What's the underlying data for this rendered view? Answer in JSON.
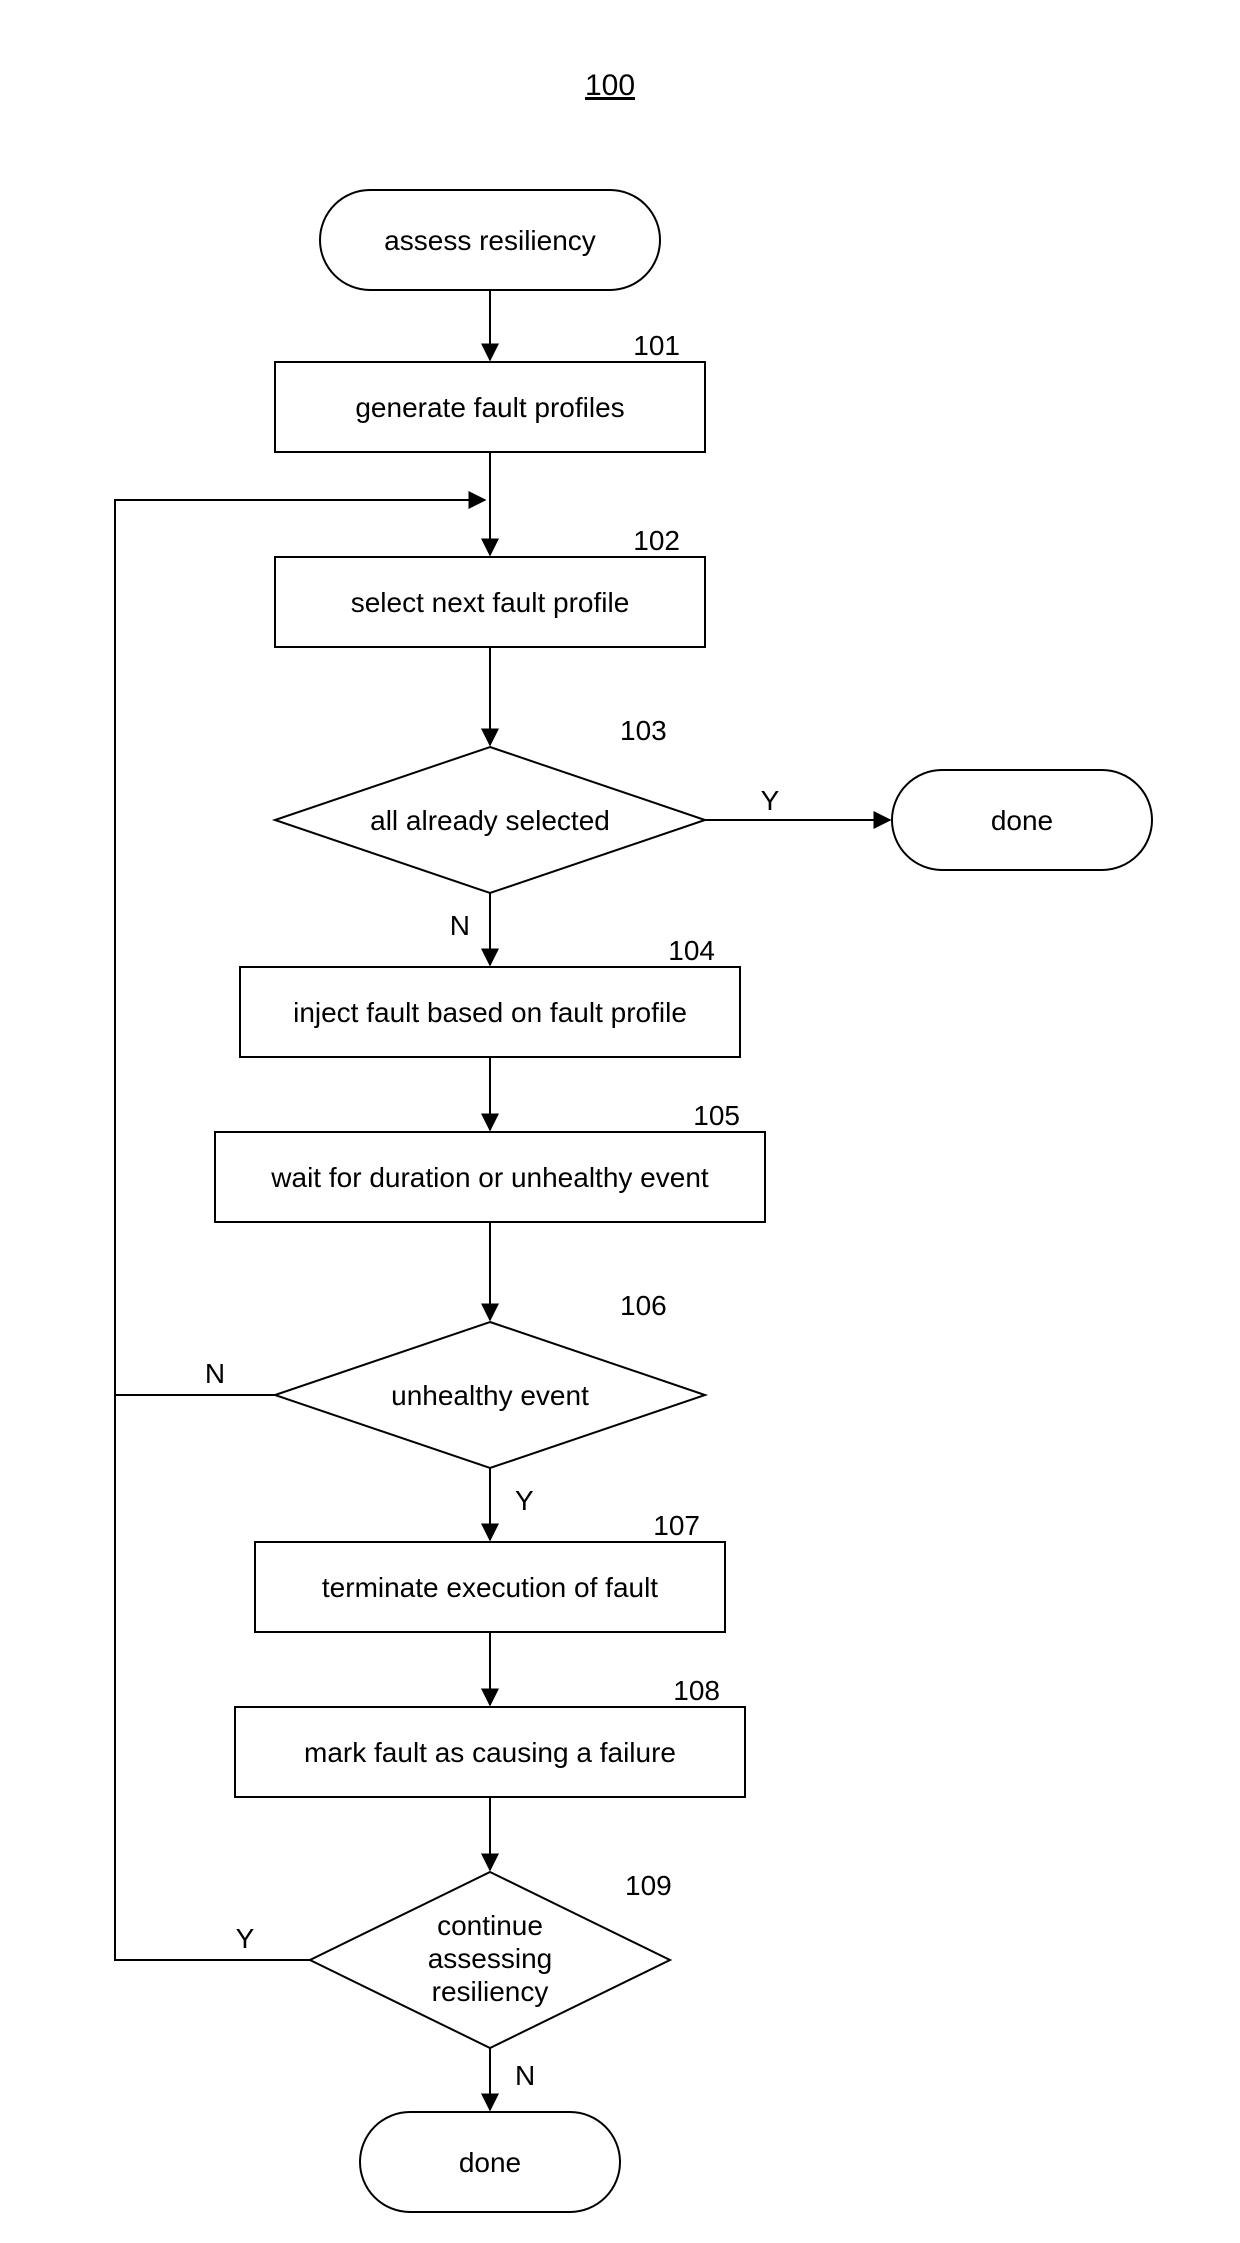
{
  "figure_number": "100",
  "nodes": {
    "start": {
      "label": "assess resiliency"
    },
    "s101": {
      "ref": "101",
      "label": "generate fault profiles"
    },
    "s102": {
      "ref": "102",
      "label": "select next fault profile"
    },
    "d103": {
      "ref": "103",
      "label": "all already selected"
    },
    "done103": {
      "label": "done"
    },
    "s104": {
      "ref": "104",
      "label": "inject fault based on fault profile"
    },
    "s105": {
      "ref": "105",
      "label": "wait for duration or unhealthy event"
    },
    "d106": {
      "ref": "106",
      "label": "unhealthy event"
    },
    "s107": {
      "ref": "107",
      "label": "terminate execution of fault"
    },
    "s108": {
      "ref": "108",
      "label": "mark fault as causing a failure"
    },
    "d109": {
      "ref": "109",
      "label_line1": "continue",
      "label_line2": "assessing",
      "label_line3": "resiliency"
    },
    "done_end": {
      "label": "done"
    }
  },
  "edges": {
    "d103_yes": "Y",
    "d103_no": "N",
    "d106_no": "N",
    "d106_yes": "Y",
    "d109_yes": "Y",
    "d109_no": "N"
  }
}
